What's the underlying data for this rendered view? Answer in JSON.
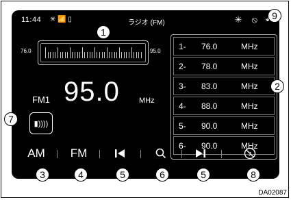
{
  "status": {
    "time": "11:44",
    "icons": [
      "bluetooth-status-icon",
      "signal-icon",
      "battery-icon"
    ]
  },
  "title": "ラジオ (FM)",
  "header_icons": [
    "bluetooth-icon",
    "no-disc-icon",
    "back-icon"
  ],
  "tuner": {
    "low": "76.0",
    "high": "95.0"
  },
  "current": {
    "band": "FM1",
    "frequency": "95.0",
    "unit": "MHz"
  },
  "presets": [
    {
      "num": "1-",
      "freq": "76.0",
      "unit": "MHz"
    },
    {
      "num": "2-",
      "freq": "78.0",
      "unit": "MHz"
    },
    {
      "num": "3-",
      "freq": "83.0",
      "unit": "MHz"
    },
    {
      "num": "4-",
      "freq": "88.0",
      "unit": "MHz"
    },
    {
      "num": "5-",
      "freq": "90.0",
      "unit": "MHz"
    },
    {
      "num": "6-",
      "freq": "90.0",
      "unit": "MHz"
    }
  ],
  "bottom_bar": {
    "am": "AM",
    "fm": "FM",
    "prev_icon": "skip-previous-icon",
    "search_icon": "search-icon",
    "next_icon": "skip-next-icon",
    "source_icon": "music-off-icon"
  },
  "sound_icon": "speaker-icon",
  "callouts": [
    "1",
    "2",
    "3",
    "4",
    "5",
    "5",
    "6",
    "7",
    "8",
    "9"
  ],
  "caption": "DA02087"
}
